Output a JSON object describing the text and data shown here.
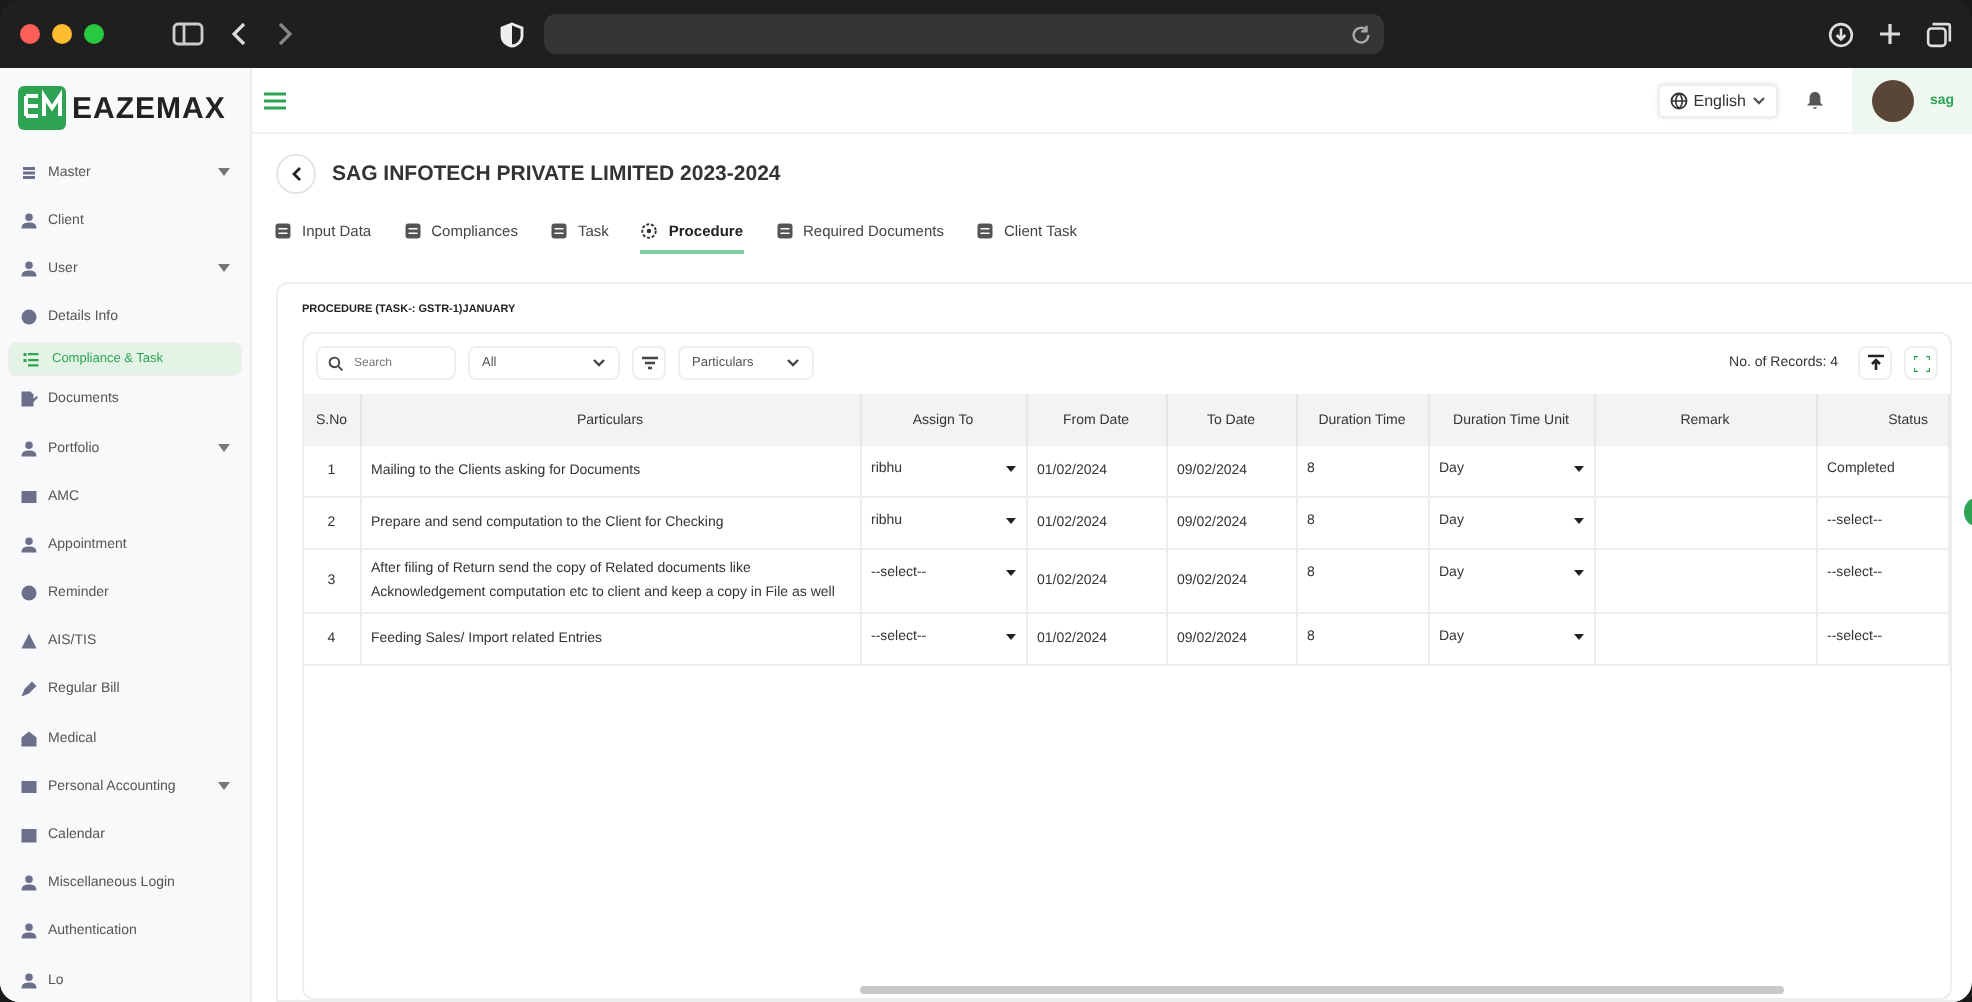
{
  "brand": {
    "name": "EAZEMAX"
  },
  "sidebar": {
    "items": [
      {
        "label": "Master",
        "expandable": true,
        "selected": false
      },
      {
        "label": "Client",
        "expandable": false,
        "selected": false
      },
      {
        "label": "User",
        "expandable": true,
        "selected": false
      },
      {
        "label": "Details Info",
        "expandable": false,
        "selected": false
      },
      {
        "label": "Compliance & Task",
        "expandable": false,
        "selected": true
      },
      {
        "label": "Documents",
        "expandable": false,
        "selected": false
      },
      {
        "label": "Portfolio",
        "expandable": true,
        "selected": false
      },
      {
        "label": "AMC",
        "expandable": false,
        "selected": false
      },
      {
        "label": "Appointment",
        "expandable": false,
        "selected": false
      },
      {
        "label": "Reminder",
        "expandable": false,
        "selected": false
      },
      {
        "label": "AIS/TIS",
        "expandable": false,
        "selected": false
      },
      {
        "label": "Regular Bill",
        "expandable": false,
        "selected": false
      },
      {
        "label": "Medical",
        "expandable": false,
        "selected": false
      },
      {
        "label": "Personal Accounting",
        "expandable": true,
        "selected": false
      },
      {
        "label": "Calendar",
        "expandable": false,
        "selected": false
      },
      {
        "label": "Miscellaneous Login",
        "expandable": false,
        "selected": false
      },
      {
        "label": "Authentication",
        "expandable": false,
        "selected": false
      },
      {
        "label": "Lo",
        "expandable": false,
        "selected": false
      }
    ]
  },
  "header": {
    "language": "English",
    "user": "sag"
  },
  "page": {
    "title": "SAG INFOTECH PRIVATE LIMITED 2023-2024"
  },
  "tabs": [
    {
      "label": "Input Data",
      "selected": false
    },
    {
      "label": "Compliances",
      "selected": false
    },
    {
      "label": "Task",
      "selected": false
    },
    {
      "label": "Procedure",
      "selected": true
    },
    {
      "label": "Required Documents",
      "selected": false
    },
    {
      "label": "Client Task",
      "selected": false
    }
  ],
  "panel": {
    "title": "PROCEDURE (TASK-: GSTR-1)JANUARY",
    "search_placeholder": "Search",
    "filter_value": "All",
    "column_select": "Particulars",
    "records": "No. of Records: 4"
  },
  "table": {
    "columns": [
      "S.No",
      "Particulars",
      "Assign To",
      "From Date",
      "To Date",
      "Duration Time",
      "Duration Time Unit",
      "Remark",
      "Status"
    ],
    "rows": [
      {
        "sno": "1",
        "particulars": "Mailing to the Clients asking for Documents",
        "assign_to": "ribhu",
        "from": "01/02/2024",
        "to": "09/02/2024",
        "duration": "8",
        "unit": "Day",
        "remark": "",
        "status": "Completed"
      },
      {
        "sno": "2",
        "particulars": "Prepare and send computation to the Client for Checking",
        "assign_to": "ribhu",
        "from": "01/02/2024",
        "to": "09/02/2024",
        "duration": "8",
        "unit": "Day",
        "remark": "",
        "status": "--select--"
      },
      {
        "sno": "3",
        "particulars": "After filing of Return send the copy of Related documents like Acknowledgement computation etc to client and keep a copy in File as well",
        "assign_to": "--select--",
        "from": "01/02/2024",
        "to": "09/02/2024",
        "duration": "8",
        "unit": "Day",
        "remark": "",
        "status": "--select--"
      },
      {
        "sno": "4",
        "particulars": "Feeding Sales/ Import related Entries",
        "assign_to": "--select--",
        "from": "01/02/2024",
        "to": "09/02/2024",
        "duration": "8",
        "unit": "Day",
        "remark": "",
        "status": "--select--"
      }
    ]
  }
}
